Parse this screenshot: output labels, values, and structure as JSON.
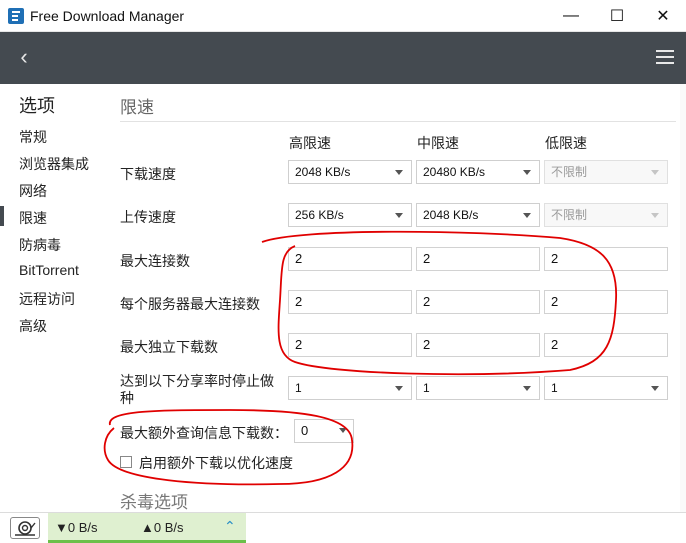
{
  "window": {
    "title": "Free Download Manager",
    "min": "—",
    "max": "☐",
    "close": "✕"
  },
  "header": {
    "back_icon": "chevron-left-icon",
    "menu_icon": "hamburger-icon"
  },
  "sidebar": {
    "title": "选项",
    "items": [
      {
        "label": "常规"
      },
      {
        "label": "浏览器集成"
      },
      {
        "label": "网络"
      },
      {
        "label": "限速"
      },
      {
        "label": "防病毒"
      },
      {
        "label": "BitTorrent"
      },
      {
        "label": "远程访问"
      },
      {
        "label": "高级"
      }
    ],
    "active_index": 3
  },
  "content": {
    "section_title": "限速",
    "columns": [
      "高限速",
      "中限速",
      "低限速"
    ],
    "rows": [
      {
        "label": "下载速度",
        "type": "select",
        "values": [
          "2048 KB/s",
          "20480 KB/s",
          "不限制"
        ],
        "disabled": [
          false,
          false,
          true
        ]
      },
      {
        "label": "上传速度",
        "type": "select",
        "values": [
          "256 KB/s",
          "2048 KB/s",
          "不限制"
        ],
        "disabled": [
          false,
          false,
          true
        ]
      },
      {
        "label": "最大连接数",
        "type": "input",
        "values": [
          "2",
          "2",
          "2"
        ]
      },
      {
        "label": "每个服务器最大连接数",
        "type": "input",
        "values": [
          "2",
          "2",
          "2"
        ]
      },
      {
        "label": "最大独立下载数",
        "type": "input",
        "values": [
          "2",
          "2",
          "2"
        ]
      },
      {
        "label": "达到以下分享率时停止做种",
        "type": "select",
        "values": [
          "1",
          "1",
          "1"
        ],
        "disabled": [
          false,
          false,
          false
        ]
      }
    ],
    "extra_queries_label": "最大额外查询信息下载数：",
    "extra_queries_value": "0",
    "optimize_checkbox_label": "启用额外下载以优化速度",
    "optimize_checked": false,
    "section2_title": "杀毒选项"
  },
  "status": {
    "snail_icon": "snail-icon",
    "download_speed": "▼0 B/s",
    "upload_speed": "▲0 B/s",
    "expand_icon": "chevron-up-icon"
  },
  "colors": {
    "header": "#444a50",
    "accent_green": "#6cc04a",
    "annotation_red": "#e00000"
  }
}
